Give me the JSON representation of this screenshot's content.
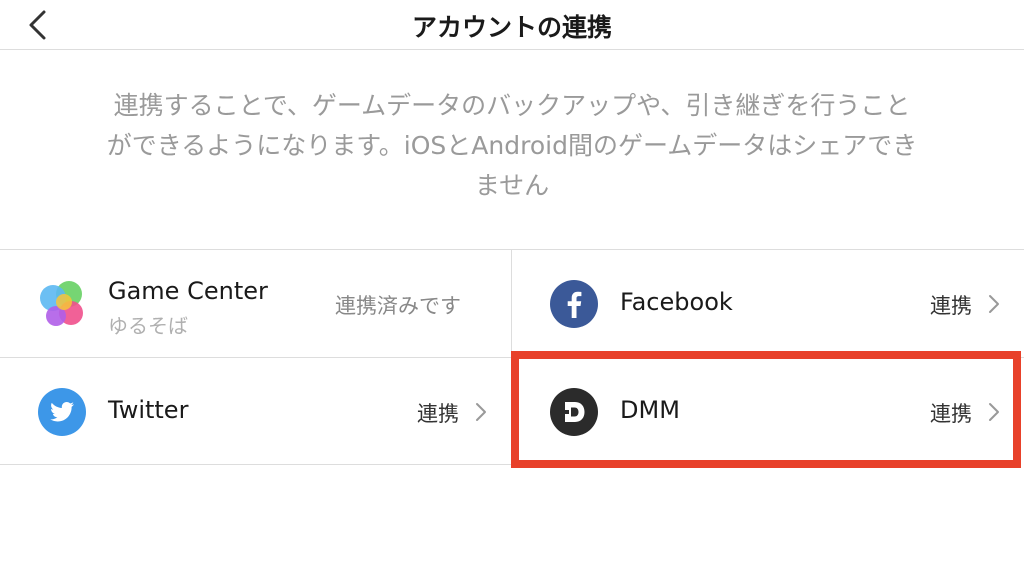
{
  "header": {
    "title": "アカウントの連携",
    "back_icon": "chevron-left-icon"
  },
  "description": {
    "lines": [
      "連携することで、ゲームデータのバックアップや、引き継ぎを行うこと",
      "ができるようになります。iOSとAndroid間のゲームデータはシェアでき",
      "ません"
    ]
  },
  "accounts": {
    "game_center": {
      "name": "Game Center",
      "sub": "ゆるそば",
      "status": "連携済みです",
      "icon": "game-center-icon"
    },
    "facebook": {
      "name": "Facebook",
      "status": "連携",
      "icon": "facebook-icon",
      "color": "#3b5998"
    },
    "twitter": {
      "name": "Twitter",
      "status": "連携",
      "icon": "twitter-icon",
      "color": "#3d97e8"
    },
    "dmm": {
      "name": "DMM",
      "status": "連携",
      "icon": "dmm-icon",
      "color": "#2b2b2b"
    }
  },
  "colors": {
    "highlight": "#e8412a",
    "divider": "#dddddd",
    "description_text": "#9a9a9a"
  }
}
